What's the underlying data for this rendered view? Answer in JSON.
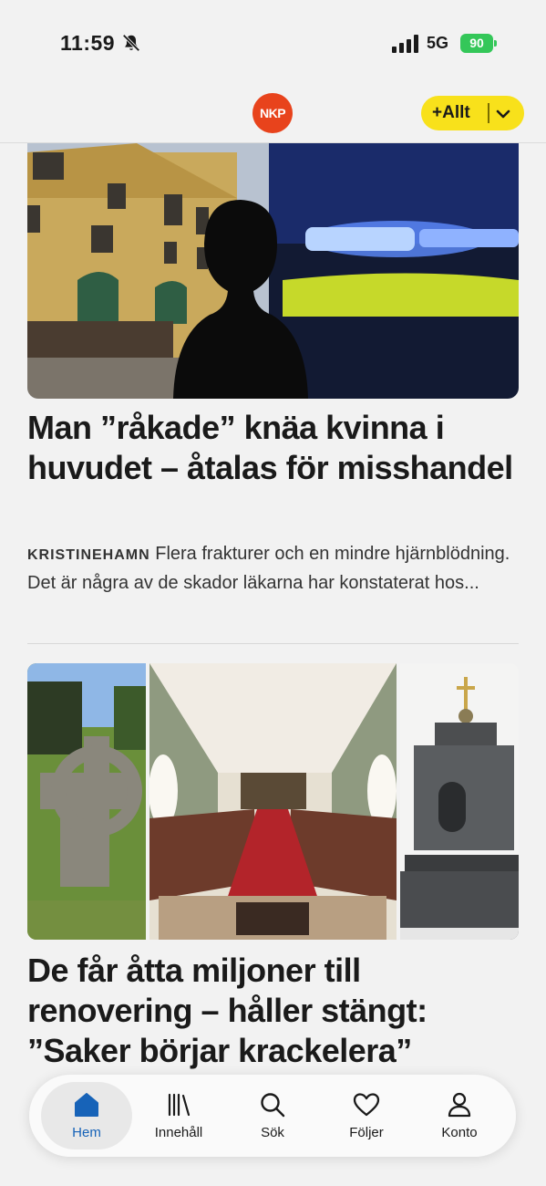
{
  "status": {
    "time": "11:59",
    "network": "5G",
    "battery": "90"
  },
  "header": {
    "logo": "NKP",
    "follow_button": "+Allt"
  },
  "articles": [
    {
      "headline": "Man ”råkade” knäa kvinna i huvudet – åtalas för misshandel",
      "kicker": "KRISTINEHAMN",
      "excerpt": "Flera frakturer och en mindre hjärnblödning. Det är några av de skador läkarna har konstaterat hos..."
    },
    {
      "headline": "De får åtta miljoner till renovering – håller stängt: ”Saker börjar krackelera”"
    }
  ],
  "tabbar": {
    "items": [
      {
        "label": "Hem",
        "icon": "home-icon"
      },
      {
        "label": "Innehåll",
        "icon": "library-icon"
      },
      {
        "label": "Sök",
        "icon": "search-icon"
      },
      {
        "label": "Följer",
        "icon": "heart-icon"
      },
      {
        "label": "Konto",
        "icon": "person-icon"
      }
    ]
  },
  "colors": {
    "brand": "#e8431c",
    "accent_yellow": "#f8e11b",
    "active_tab": "#1763b8"
  }
}
